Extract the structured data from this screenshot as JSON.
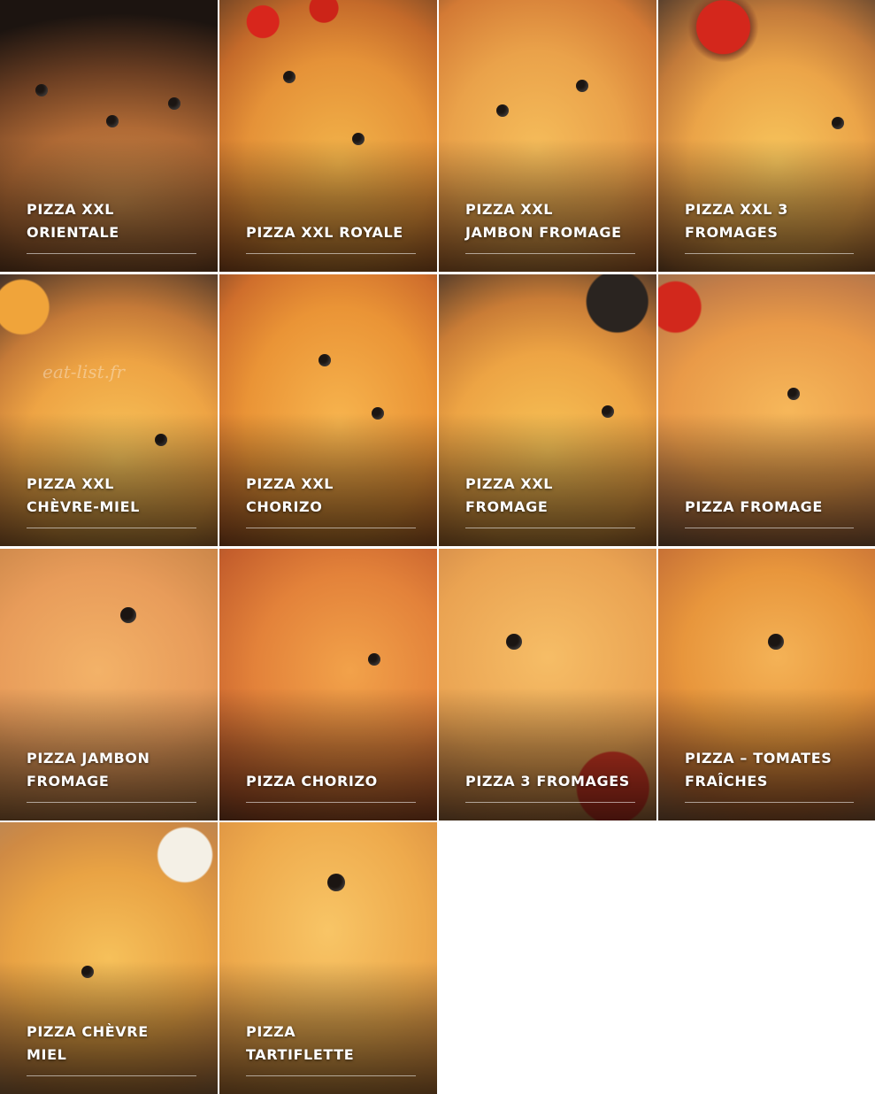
{
  "watermark": "eat-list.fr",
  "menu": {
    "items": [
      {
        "label": "PIZZA XXL\nORIENTALE"
      },
      {
        "label": "PIZZA XXL ROYALE"
      },
      {
        "label": "PIZZA XXL\nJAMBON FROMAGE"
      },
      {
        "label": "PIZZA XXL 3\nFROMAGES"
      },
      {
        "label": "PIZZA XXL\nCHÈVRE-MIEL"
      },
      {
        "label": "PIZZA XXL\nCHORIZO"
      },
      {
        "label": "PIZZA XXL\nFROMAGE"
      },
      {
        "label": "PIZZA FROMAGE"
      },
      {
        "label": "PIZZA JAMBON\nFROMAGE"
      },
      {
        "label": "PIZZA CHORIZO"
      },
      {
        "label": "PIZZA 3 FROMAGES"
      },
      {
        "label": "PIZZA – TOMATES\nFRAÎCHES"
      },
      {
        "label": "PIZZA CHÈVRE\nMIEL"
      },
      {
        "label": "PIZZA\nTARTIFLETTE"
      }
    ]
  }
}
